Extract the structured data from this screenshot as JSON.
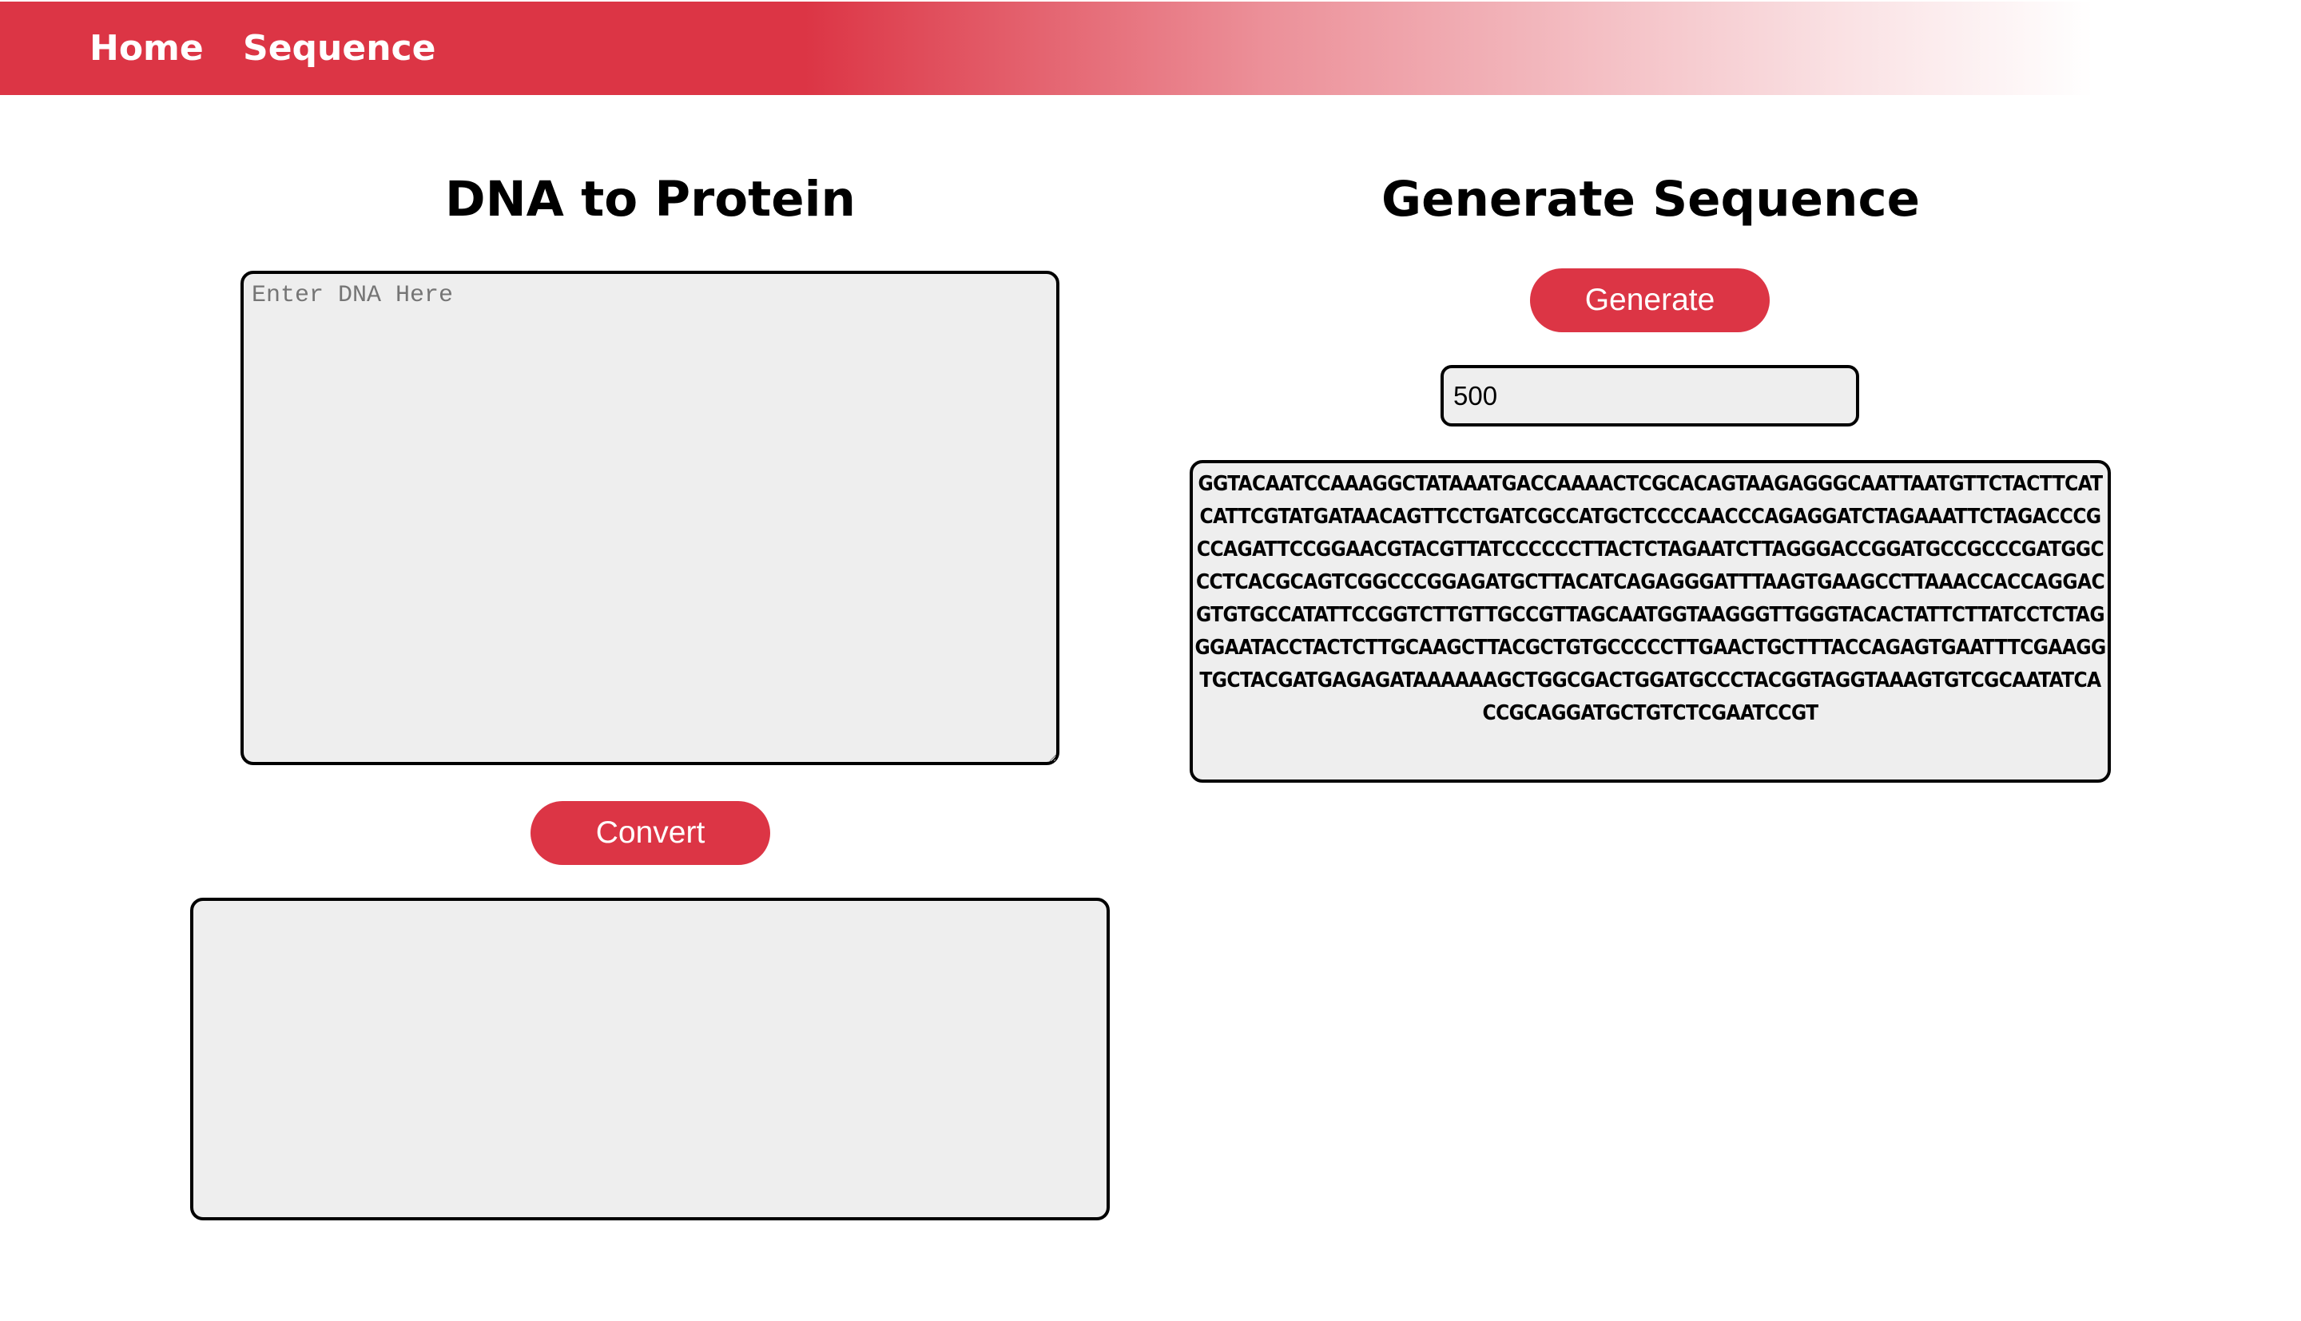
{
  "nav": {
    "home_label": "Home",
    "sequence_label": "Sequence"
  },
  "dna_to_protein": {
    "title": "DNA to Protein",
    "input_placeholder": "Enter DNA Here",
    "input_value": "",
    "convert_label": "Convert",
    "output_text": ""
  },
  "generate_sequence": {
    "title": "Generate Sequence",
    "generate_label": "Generate",
    "length_value": "500",
    "sequence_text": "GGTACAATCCAAAGGCTATAAATGACCAAAACTCGCACAGTAAGAGGGCAATTAATGTTCTACTTCATCATTCGTATGATAACAGTTCCTGATCGCCATGCTCCCCAACCCAGAGGATCTAGAAATTCTAGACCCGCCAGATTCCGGAACGTACGTTATCCCCCCTTACTCTAGAATCTTAGGGACCGGATGCCGCCCGATGGCCCTCACGCAGTCGGCCCGGAGATGCTTACATCAGAGGGATTTAAGTGAAGCCTTAAACCACCAGGACGTGTGCCATATTCCGGTCTTGTTGCCGTTAGCAATGGTAAGGGTTGGGTACACTATTCTTATCCTCTAGGGAATACCTACTCTTGCAAGCTTACGCTGTGCCCCCTTGAACTGCTTTACCAGAGTGAATTTCGAAGGTGCTACGATGAGAGATAAAAAAGCTGGCGACTGGATGCCCTACGGTAGGTAAAGTGTCGCAATATCACCGCAGGATGCTGTCTCGAATCCGT"
  },
  "colors": {
    "accent": "#dc3545",
    "field_background": "#eeeeee",
    "border": "#000000"
  }
}
